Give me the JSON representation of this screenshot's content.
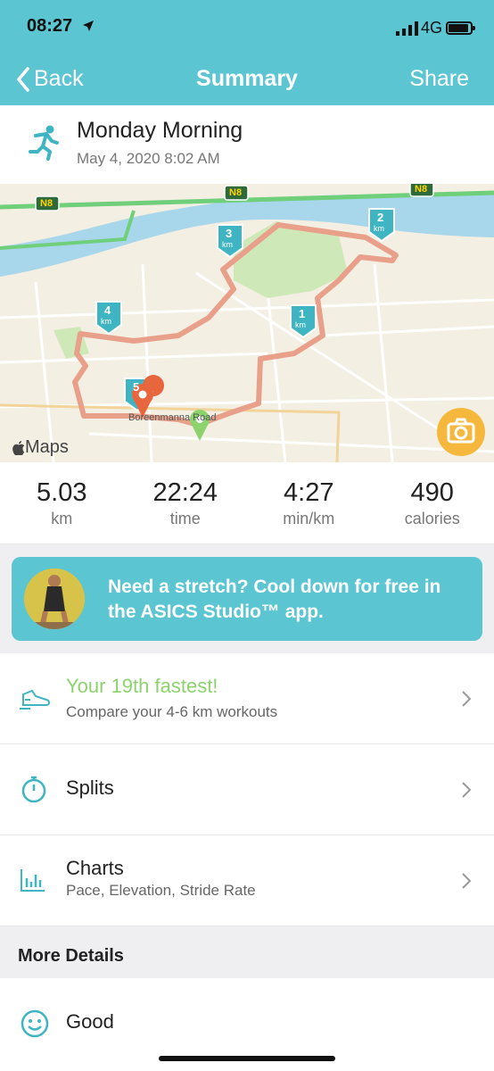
{
  "status_bar": {
    "time": "08:27",
    "network": "4G"
  },
  "nav": {
    "back_label": "Back",
    "title": "Summary",
    "share_label": "Share"
  },
  "workout": {
    "title": "Monday Morning",
    "date": "May 4, 2020 8:02 AM"
  },
  "map": {
    "road_labels": [
      "N8",
      "N8",
      "N8"
    ],
    "street_label": "Boreenmanna Road",
    "km_markers": [
      "1",
      "2",
      "3",
      "4",
      "5"
    ],
    "km_unit": "km",
    "attribution": "Maps"
  },
  "stats": [
    {
      "value": "5.03",
      "unit": "km"
    },
    {
      "value": "22:24",
      "unit": "time"
    },
    {
      "value": "4:27",
      "unit": "min/km"
    },
    {
      "value": "490",
      "unit": "calories"
    }
  ],
  "banner": {
    "text": "Need a stretch? Cool down for free in the ASICS Studio™ app."
  },
  "rows": [
    {
      "title": "Your 19th fastest!",
      "subtitle": "Compare your 4-6 km workouts",
      "icon": "shoe-icon"
    },
    {
      "title": "Splits",
      "subtitle": "",
      "icon": "stopwatch-icon"
    },
    {
      "title": "Charts",
      "subtitle": "Pace, Elevation, Stride Rate",
      "icon": "bar-chart-icon"
    }
  ],
  "section": {
    "title": "More Details"
  },
  "feeling": {
    "label": "Good",
    "icon": "smiley-icon"
  },
  "colors": {
    "accent": "#5bc5d1",
    "highlight": "#8cd36e",
    "route": "#e8a08a",
    "camera": "#f5b83c"
  }
}
